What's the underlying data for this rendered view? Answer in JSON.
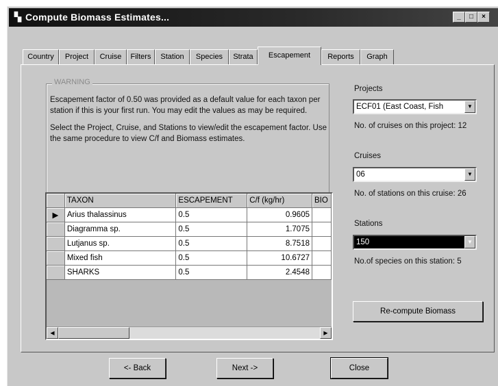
{
  "window": {
    "title": "Compute Biomass Estimates...",
    "controls": [
      "_",
      "□",
      "×"
    ]
  },
  "tabs": [
    {
      "label": "Country",
      "active": false
    },
    {
      "label": "Project",
      "active": false
    },
    {
      "label": "Cruise",
      "active": false
    },
    {
      "label": "Filters",
      "active": false
    },
    {
      "label": "Station",
      "active": false
    },
    {
      "label": "Species",
      "active": false
    },
    {
      "label": "Strata",
      "active": false
    },
    {
      "label": "Escapement",
      "active": true
    },
    {
      "label": "Reports",
      "active": false
    },
    {
      "label": "Graph",
      "active": false
    }
  ],
  "warning": {
    "label": "WARNING",
    "paragraph1": "Escapement factor of 0.50 was provided as a default value for each taxon per station if this is your first run. You may edit the values as may be required.",
    "paragraph2": "Select the Project, Cruise, and Stations to view/edit the escapement factor. Use the same procedure to view C/f and Biomass estimates."
  },
  "grid": {
    "columns": [
      "TAXON",
      "ESCAPEMENT",
      "C/f (kg/hr)",
      "BIO"
    ],
    "rows": [
      {
        "taxon": "Arius thalassinus",
        "escapement": "0.5",
        "cf": "0.9605"
      },
      {
        "taxon": "Diagramma sp.",
        "escapement": "0.5",
        "cf": "1.7075"
      },
      {
        "taxon": "Lutjanus sp.",
        "escapement": "0.5",
        "cf": "8.7518"
      },
      {
        "taxon": "Mixed fish",
        "escapement": "0.5",
        "cf": "10.6727"
      },
      {
        "taxon": "SHARKS",
        "escapement": "0.5",
        "cf": "2.4548"
      }
    ],
    "current_row_marker": "▶"
  },
  "right": {
    "projects_label": "Projects",
    "project_value": "ECF01 (East Coast, Fish",
    "cruises_on_project": "No. of cruises on this project: 12",
    "cruises_label": "Cruises",
    "cruise_value": "06",
    "stations_on_cruise": "No. of stations on this cruise: 26",
    "stations_label": "Stations",
    "station_value": "150",
    "species_on_station": "No.of species on this station: 5",
    "recompute_button": "Re-compute Biomass"
  },
  "buttons": {
    "back": "<- Back",
    "next": "Next ->",
    "close": "Close"
  },
  "icons": {
    "dropdown": "▼",
    "scroll_left": "◀",
    "scroll_right": "▶"
  }
}
